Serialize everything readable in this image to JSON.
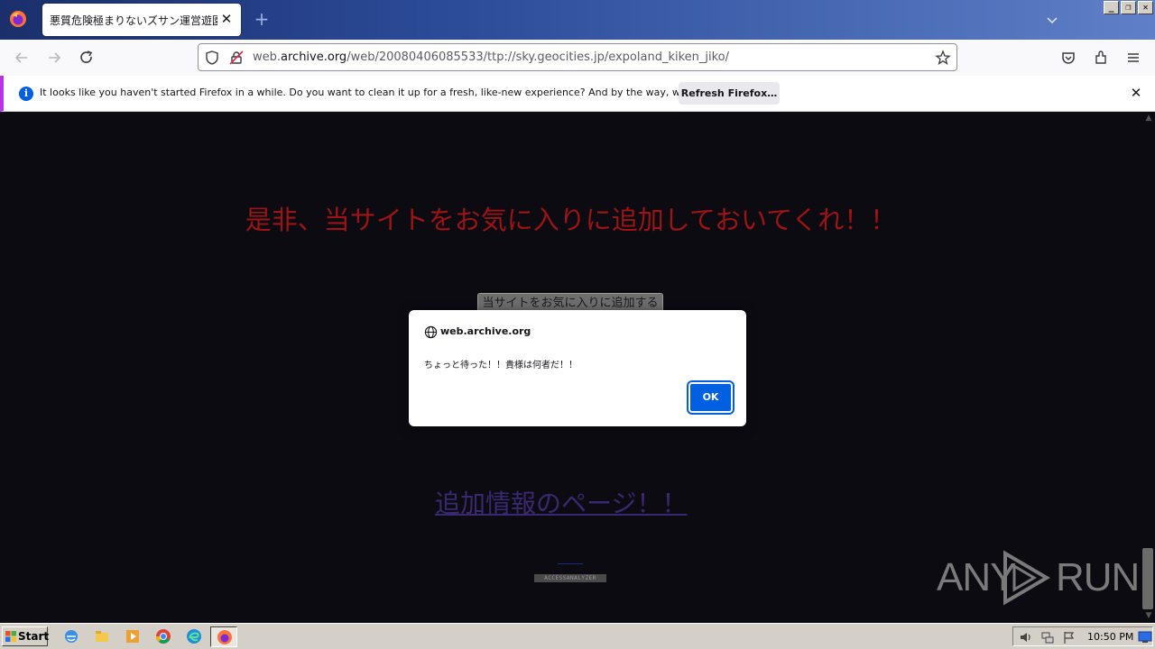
{
  "browser": {
    "tab_title": "悪質危険極まりないズサン運営遊園地",
    "url_prefix": "web.",
    "url_domain": "archive.org",
    "url_path": "/web/20080406085533/ttp://sky.geocities.jp/expoland_kiken_jiko/"
  },
  "notification": {
    "message": "It looks like you haven't started Firefox in a while. Do you want to clean it up for a fresh, like-new experience? And by the way, welcome back!",
    "button": "Refresh Firefox…"
  },
  "page": {
    "headline": "是非、当サイトをお気に入りに追加しておいてくれ！！",
    "favorite_button": "当サイトをお気に入りに追加する",
    "info_link": "追加情報のページ！！",
    "counter": "ACCESSANALYZER",
    "watermark_left": "ANY",
    "watermark_right": "RUN"
  },
  "dialog": {
    "origin": "web.archive.org",
    "message": "ちょっと待った！！貴様は何者だ！！",
    "ok": "OK"
  },
  "taskbar": {
    "start": "Start",
    "clock": "10:50 PM"
  },
  "colors": {
    "headline": "#9c1414",
    "accent": "#0060df",
    "page_bg": "#0c0b12"
  }
}
